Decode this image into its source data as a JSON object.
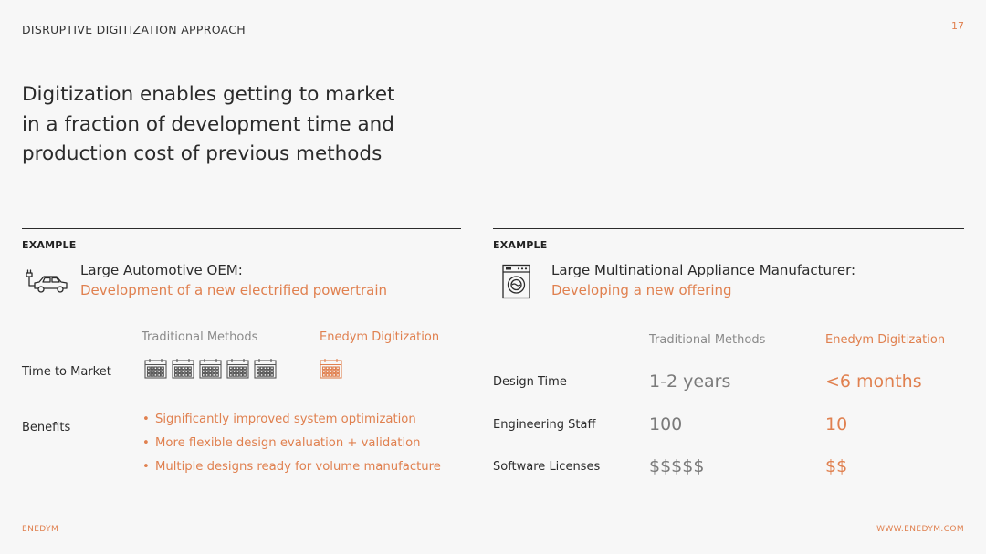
{
  "header": {
    "section_title": "DISRUPTIVE DIGITIZATION APPROACH",
    "page_number": "17"
  },
  "headline": {
    "lines": [
      "Digitization enables getting to market",
      "in a fraction of development time and",
      "production cost of previous methods"
    ]
  },
  "left_example": {
    "label": "EXAMPLE",
    "icon": "electric-car-icon",
    "title": "Large Automotive OEM:",
    "subtitle": "Development of a new electrified powertrain",
    "columns": {
      "traditional": "Traditional Methods",
      "enedym": "Enedym Digitization"
    },
    "time_to_market": {
      "label": "Time to Market",
      "traditional_calendars": 5,
      "enedym_calendars": 1
    },
    "benefits": {
      "label": "Benefits",
      "items": [
        "Significantly improved system optimization",
        "More flexible design evaluation + validation",
        "Multiple designs ready for volume manufacture"
      ]
    }
  },
  "right_example": {
    "label": "EXAMPLE",
    "icon": "washing-machine-icon",
    "title": "Large Multinational Appliance Manufacturer:",
    "subtitle": "Developing a new offering",
    "columns": {
      "traditional": "Traditional Methods",
      "enedym": "Enedym Digitization"
    },
    "rows": [
      {
        "label": "Design Time",
        "traditional": "1-2 years",
        "enedym": "<6 months"
      },
      {
        "label": "Engineering Staff",
        "traditional": "100",
        "enedym": "10"
      },
      {
        "label": "Software Licenses",
        "traditional": "$$$$$",
        "enedym": "$$"
      }
    ]
  },
  "footer": {
    "brand": "ENEDYM",
    "website": "WWW.ENEDYM.COM"
  },
  "colors": {
    "accent": "#e0804f",
    "text": "#2b2b2b",
    "muted": "#7a7a7a",
    "background": "#f7f7f7"
  }
}
